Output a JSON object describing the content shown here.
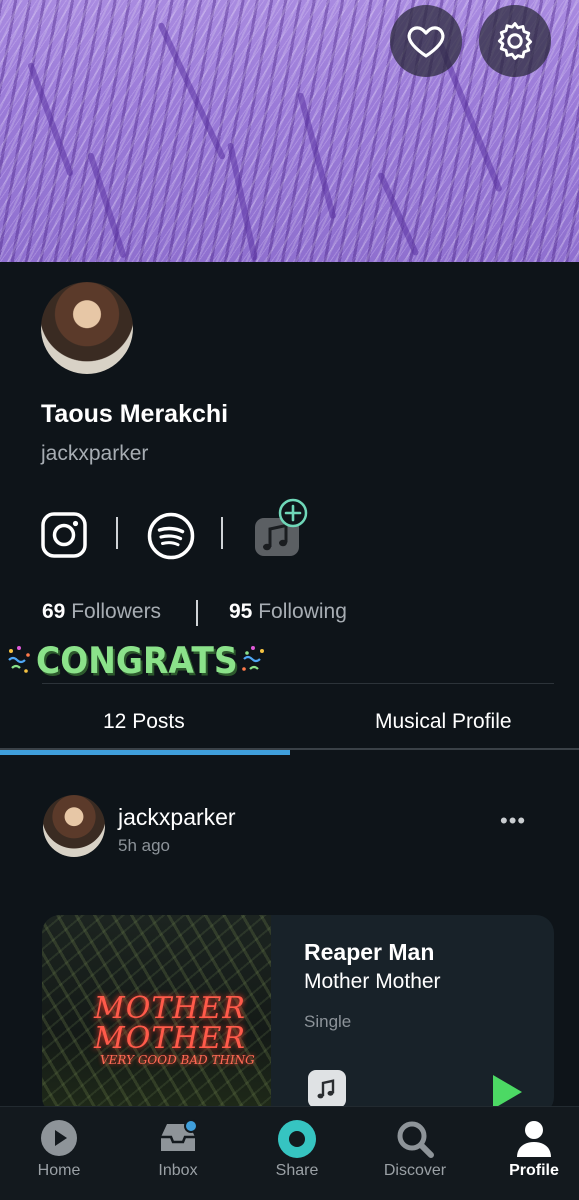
{
  "profile": {
    "name": "Taous Merakchi",
    "handle": "jackxparker",
    "followers_count": "69",
    "followers_label": "Followers",
    "following_count": "95",
    "following_label": "Following",
    "badge_text": "CONGRATS"
  },
  "header_icons": [
    "heart-icon",
    "gear-icon"
  ],
  "social_icons": [
    "instagram-icon",
    "spotify-icon",
    "apple-music-icon",
    "add-icon"
  ],
  "tabs": [
    {
      "label": "12 Posts",
      "active": true
    },
    {
      "label": "Musical Profile",
      "active": false
    }
  ],
  "post": {
    "user": "jackxparker",
    "time": "5h ago",
    "more": "•••",
    "card": {
      "title": "Reaper Man",
      "artist": "Mother Mother",
      "type": "Single",
      "art_line1": "MOTHER",
      "art_line2": "MOTHER",
      "art_line3": "VERY GOOD BAD THING"
    }
  },
  "nav": [
    {
      "label": "Home",
      "icon": "play-circle-icon",
      "active": false
    },
    {
      "label": "Inbox",
      "icon": "inbox-icon",
      "active": false
    },
    {
      "label": "Share",
      "icon": "share-icon",
      "active": false
    },
    {
      "label": "Discover",
      "icon": "search-icon",
      "active": false
    },
    {
      "label": "Profile",
      "icon": "person-icon",
      "active": true
    }
  ],
  "colors": {
    "background": "#0e1419",
    "accent_blue": "#3f9fdc",
    "share_teal": "#36c4c1",
    "badge_green": "#8be28a",
    "play_green": "#4cd964",
    "notification_dot": "#3f9fdc"
  }
}
